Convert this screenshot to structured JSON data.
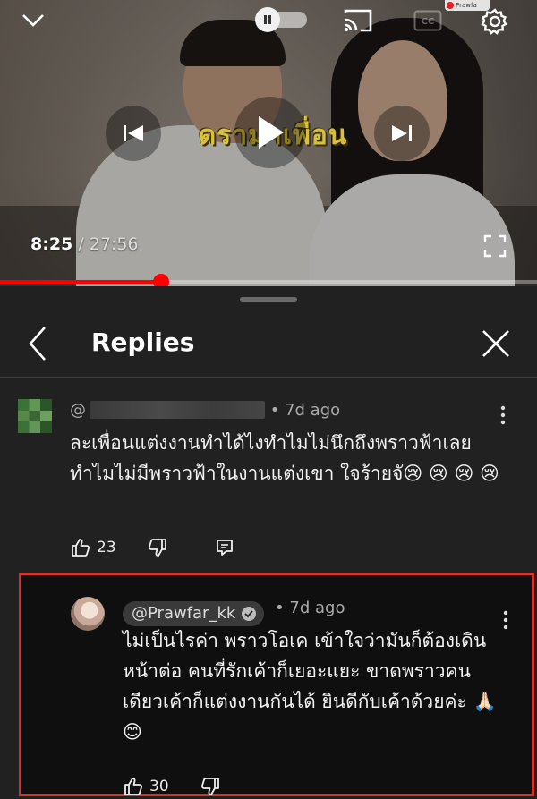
{
  "player": {
    "overlay_title": "ดราม่าเพื่อน",
    "channel_badge": "Prawfa",
    "current_time": "8:25",
    "separator": " / ",
    "duration": "27:56",
    "progress_fraction": 0.3
  },
  "panel": {
    "title": "Replies"
  },
  "comments": [
    {
      "handle_prefix": "@",
      "age": "• 7d ago",
      "text": "ละเพื่อนแต่งงานทำได้ไงทำไมไม่นึกถึงพราวฟ้าเลย ทำไมไม่มีพราวฟ้าในงานแต่งเขา ใจร้ายจั😢 😢 😢 😢",
      "likes": "23"
    },
    {
      "handle": "@Prawfar_kk",
      "age": "• 7d ago",
      "text": "ไม่เป็นไรค่า พราวโอเค เข้าใจว่ามันก็ต้องเดิน หน้าต่อ คนที่รักเค้าก็เยอะแยะ ขาดพราวคน เดียวเค้าก็แต่งงานกันได้ ยินดีกับเค้าด้วยค่ะ 🙏🏻 😊",
      "likes": "30"
    }
  ],
  "colors": {
    "accent_red": "#ff0000",
    "highlight_border": "#d1332e",
    "panel_bg": "#212121"
  }
}
